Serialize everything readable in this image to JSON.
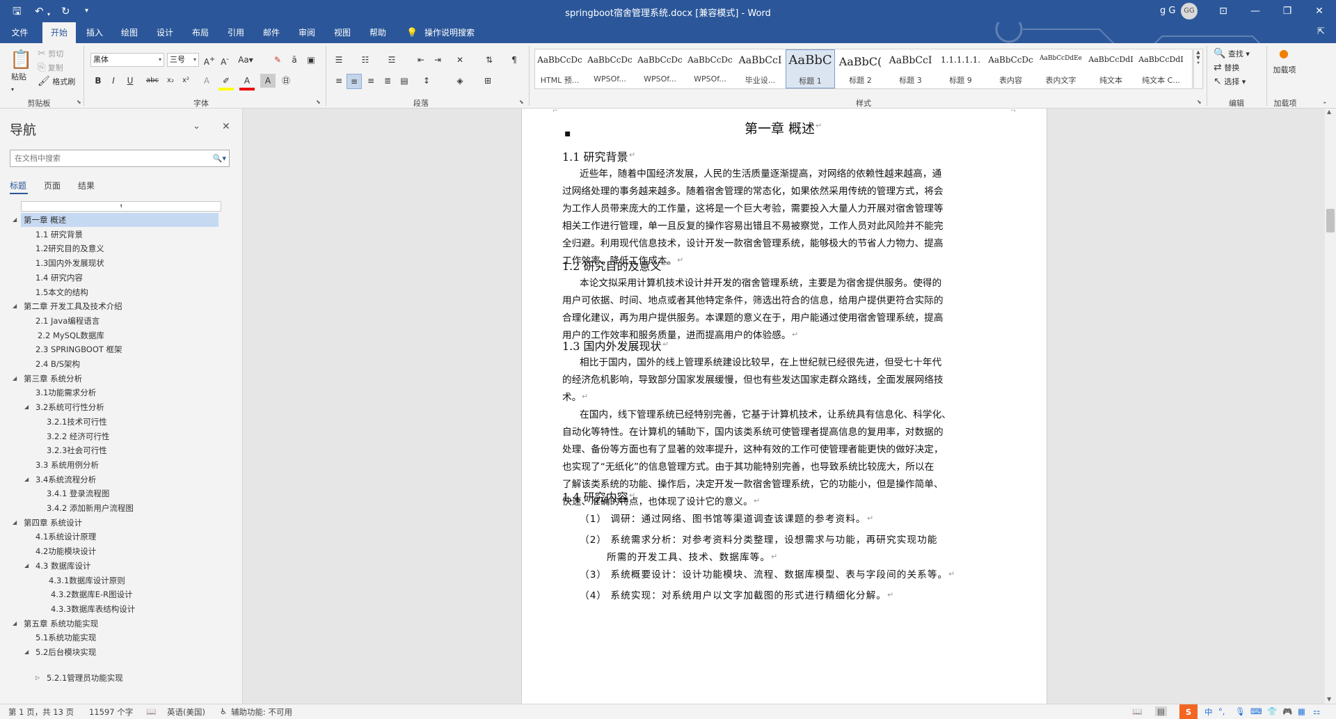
{
  "titlebar": {
    "doc_title": "springboot宿舍管理系统.docx [兼容模式] - Word",
    "user_name": "g G",
    "avatar_initials": "GG"
  },
  "ribbon_tabs": [
    "文件",
    "开始",
    "插入",
    "绘图",
    "设计",
    "布局",
    "引用",
    "邮件",
    "审阅",
    "视图",
    "帮助"
  ],
  "active_tab": "开始",
  "tell_me": "操作说明搜索",
  "clipboard": {
    "paste": "粘贴",
    "cut": "剪切",
    "copy": "复制",
    "format_painter": "格式刷",
    "label": "剪贴板"
  },
  "font": {
    "name": "黑体",
    "size": "三号",
    "label": "字体"
  },
  "paragraph": {
    "label": "段落"
  },
  "styles": {
    "label": "样式",
    "items": [
      {
        "preview": "AaBbCcDc",
        "name": "HTML 预..."
      },
      {
        "preview": "AaBbCcDc",
        "name": "WPSOf..."
      },
      {
        "preview": "AaBbCcDc",
        "name": "WPSOf..."
      },
      {
        "preview": "AaBbCcDc",
        "name": "WPSOf..."
      },
      {
        "preview": "AaBbCcI",
        "name": "毕业设..."
      },
      {
        "preview": "AaBbC",
        "name": "标题 1"
      },
      {
        "preview": "AaBbC(",
        "name": "标题 2"
      },
      {
        "preview": "AaBbCcI",
        "name": "标题 3"
      },
      {
        "preview": "1.1.1.1.1.",
        "name": "标题 9"
      },
      {
        "preview": "AaBbCcDc",
        "name": "表内容"
      },
      {
        "preview": "AaBbCcDdEe",
        "name": "表内文字"
      },
      {
        "preview": "AaBbCcDdI",
        "name": "纯文本"
      },
      {
        "preview": "AaBbCcDdI",
        "name": "纯文本 C..."
      }
    ]
  },
  "editing": {
    "find": "查找",
    "replace": "替换",
    "select": "选择",
    "label": "编辑"
  },
  "addins": {
    "button": "加载项",
    "label": "加载项"
  },
  "nav": {
    "title": "导航",
    "search_placeholder": "在文档中搜索",
    "tabs": [
      "标题",
      "页面",
      "结果"
    ],
    "items": [
      {
        "text": "第一章  概述",
        "level": 1,
        "expanded": true,
        "selected": true
      },
      {
        "text": "1.1 研究背景",
        "level": 2
      },
      {
        "text": "1.2研究目的及意义",
        "level": 2
      },
      {
        "text": "1.3国内外发展现状",
        "level": 2
      },
      {
        "text": "1.4 研究内容",
        "level": 2
      },
      {
        "text": "1.5本文的结构",
        "level": 2
      },
      {
        "text": "第二章 开发工具及技术介绍",
        "level": 1,
        "expanded": true
      },
      {
        "text": "2.1 Java编程语言",
        "level": 2
      },
      {
        "text": "2.2 MySQL数据库",
        "level": 2,
        "indent": 1
      },
      {
        "text": "2.3 SPRINGBOOT 框架",
        "level": 2
      },
      {
        "text": "2.4 B/S架构",
        "level": 2
      },
      {
        "text": "第三章  系统分析",
        "level": 1,
        "expanded": true
      },
      {
        "text": "3.1功能需求分析",
        "level": 2
      },
      {
        "text": "3.2系统可行性分析",
        "level": 2,
        "expanded": true
      },
      {
        "text": "3.2.1技术可行性",
        "level": 3
      },
      {
        "text": "3.2.2 经济可行性",
        "level": 3
      },
      {
        "text": "3.2.3社会可行性",
        "level": 3
      },
      {
        "text": "3.3  系统用例分析",
        "level": 2
      },
      {
        "text": "3.4系统流程分析",
        "level": 2,
        "expanded": true
      },
      {
        "text": "3.4.1 登录流程图",
        "level": 3
      },
      {
        "text": "3.4.2 添加新用户流程图",
        "level": 3
      },
      {
        "text": "第四章  系统设计",
        "level": 1,
        "expanded": true
      },
      {
        "text": "4.1系统设计原理",
        "level": 2
      },
      {
        "text": "4.2功能模块设计",
        "level": 2
      },
      {
        "text": "4.3 数据库设计",
        "level": 2,
        "expanded": true
      },
      {
        "text": "4.3.1数据库设计原则",
        "level": 3,
        "indent": 1
      },
      {
        "text": "4.3.2数据库E-R图设计",
        "level": 3,
        "indent": 2
      },
      {
        "text": "4.3.3数据库表结构设计",
        "level": 3,
        "indent": 2
      },
      {
        "text": "第五章  系统功能实现",
        "level": 1,
        "expanded": true
      },
      {
        "text": "5.1系统功能实现",
        "level": 2
      },
      {
        "text": "5.2后台模块实现",
        "level": 2,
        "expanded": true
      },
      {
        "text": "5.2.1管理员功能实现",
        "level": 3,
        "collapsed": true,
        "gap": true
      }
    ]
  },
  "document": {
    "chapter_title": "第一章  概述",
    "sections": [
      {
        "heading": "1.1  研究背景",
        "lines": [
          "近些年，随着中国经济发展，人民的生活质量逐渐提高，对网络的依赖性越来越高，通",
          "过网络处理的事务越来越多。随着宿舍管理的常态化，如果依然采用传统的管理方式，将会",
          "为工作人员带来庞大的工作量，这将是一个巨大考验，需要投入大量人力开展对宿舍管理等",
          "相关工作进行管理，单一且反复的操作容易出错且不易被察觉，工作人员对此风险并不能完",
          "全归避。利用现代信息技术，设计开发一款宿舍管理系统，能够极大的节省人力物力、提高",
          "工作效率、降低工作成本。"
        ]
      },
      {
        "heading": "1.2 研究目的及意义",
        "lines": [
          "本论文拟采用计算机技术设计并开发的宿舍管理系统，主要是为宿舍提供服务。使得的",
          "用户可依据、时间、地点或者其他特定条件，筛选出符合的信息，给用户提供更符合实际的",
          "合理化建议，再为用户提供服务。本课题的意义在于，用户能通过使用宿舍管理系统，提高",
          "用户的工作效率和服务质量，进而提高用户的体验感。"
        ]
      },
      {
        "heading": "1.3 国内外发展现状",
        "lines": [
          "相比于国内，国外的线上管理系统建设比较早，在上世纪就已经很先进，但受七十年代",
          "的经济危机影响，导致部分国家发展缓慢，但也有些发达国家走群众路线，全面发展网络技",
          "术。",
          "在国内，线下管理系统已经特别完善，它基于计算机技术，让系统具有信息化、科学化、",
          "自动化等特性。在计算机的辅助下，国内该类系统可使管理者提高信息的复用率，对数据的",
          "处理、备份等方面也有了显著的效率提升，这种有效的工作可使管理者能更快的做好决定，",
          "也实现了“无纸化”的信息管理方式。由于其功能特别完善，也导致系统比较庞大，所以在",
          "了解该类系统的功能、操作后，决定开发一款宿舍管理系统，它的功能小，但是操作简单、",
          "快速、准确的特点，也体现了设计它的意义。"
        ]
      },
      {
        "heading": "1.4  研究内容",
        "lines": [
          "（1）   调研：通过网络、图书馆等渠道调查该课题的参考资料。",
          "（2）   系统需求分析：对参考资料分类整理，设想需求与功能，再研究实现功能",
          "所需的开发工具、技术、数据库等。",
          "（3）   系统概要设计：设计功能模块、流程、数据库模型、表与字段间的关系等。",
          "（4）   系统实现：对系统用户以文字加截图的形式进行精细化分解。"
        ]
      }
    ]
  },
  "status": {
    "page": "第 1 页，共 13 页",
    "words": "11597 个字",
    "language": "英语(美国)",
    "accessibility": "辅助功能: 不可用"
  },
  "ime": {
    "label": "中"
  },
  "colors": {
    "brand": "#2b579a",
    "ribbon": "#f3f3f3",
    "canvas": "#e6e6e6",
    "nav_selected": "#c5d9f1"
  }
}
